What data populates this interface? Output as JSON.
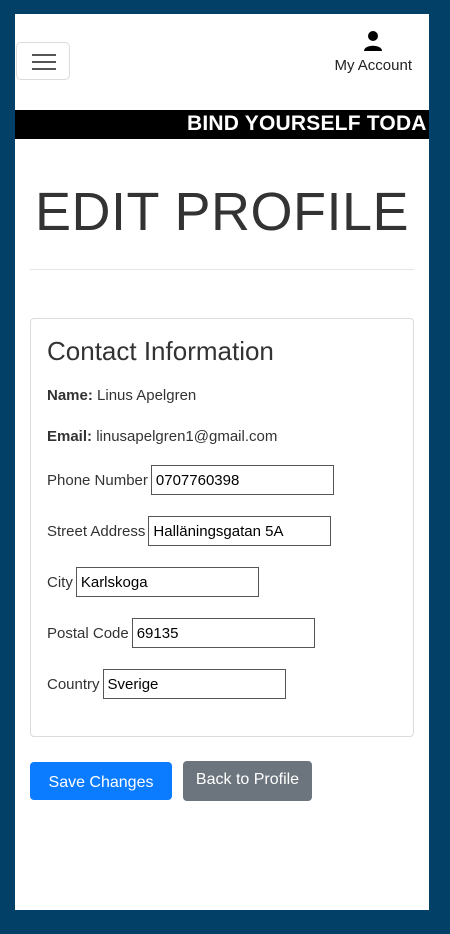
{
  "header": {
    "account_label": "My Account"
  },
  "banner": {
    "text": "BIND YOURSELF TODA"
  },
  "page": {
    "title": "EDIT PROFILE"
  },
  "contact": {
    "title": "Contact Information",
    "name_label": "Name:",
    "name_value": "Linus Apelgren",
    "email_label": "Email:",
    "email_value": "linusapelgren1@gmail.com",
    "fields": [
      {
        "label": "Phone Number",
        "value": "0707760398"
      },
      {
        "label": "Street Address",
        "value": "Halläningsgatan 5A"
      },
      {
        "label": "City",
        "value": "Karlskoga"
      },
      {
        "label": "Postal Code",
        "value": "69135"
      },
      {
        "label": "Country",
        "value": "Sverige"
      }
    ]
  },
  "actions": {
    "save_label": "Save Changes",
    "back_label": "Back to Profile"
  },
  "colors": {
    "outer_background": "#034068",
    "primary_button": "#0b7bff",
    "secondary_button": "#6c757d",
    "banner": "#000000"
  }
}
